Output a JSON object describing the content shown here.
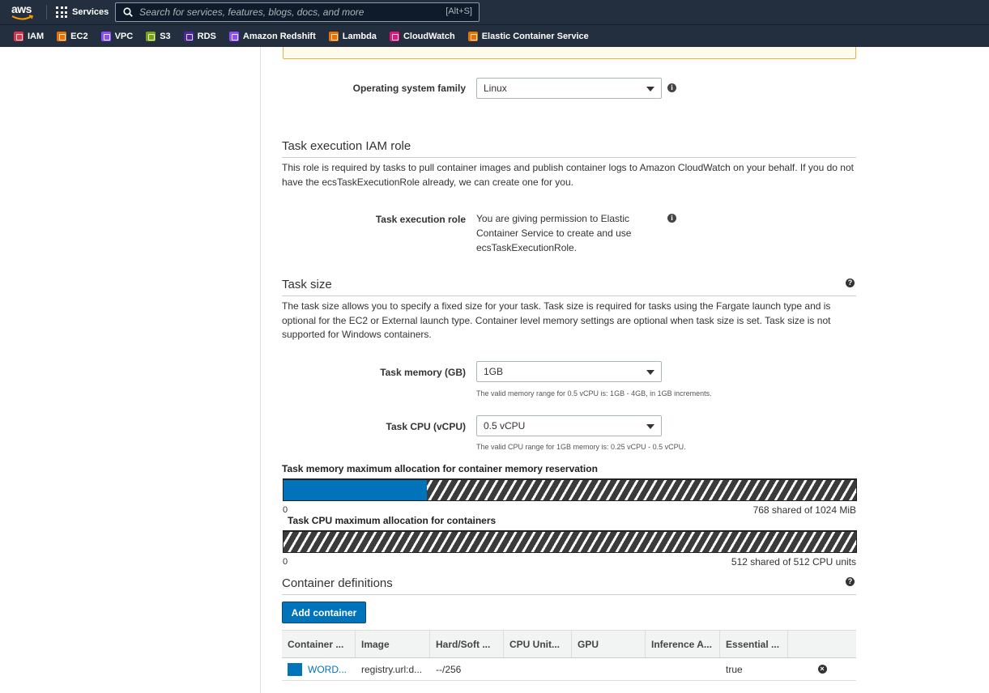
{
  "header": {
    "logo_text": "aws",
    "services_label": "Services",
    "search_placeholder": "Search for services, features, blogs, docs, and more",
    "search_shortcut": "[Alt+S]"
  },
  "favorites": [
    {
      "label": "IAM",
      "color": "#dd344c"
    },
    {
      "label": "EC2",
      "color": "#ed7100"
    },
    {
      "label": "VPC",
      "color": "#8c4fff"
    },
    {
      "label": "S3",
      "color": "#7aa116"
    },
    {
      "label": "RDS",
      "color": "#4d27a8"
    },
    {
      "label": "Amazon Redshift",
      "color": "#8c4fff"
    },
    {
      "label": "Lambda",
      "color": "#ed7100"
    },
    {
      "label": "CloudWatch",
      "color": "#e7157b"
    },
    {
      "label": "Elastic Container Service",
      "color": "#ed7100"
    }
  ],
  "os_family": {
    "label": "Operating system family",
    "value": "Linux"
  },
  "task_execution": {
    "title": "Task execution IAM role",
    "description": "This role is required by tasks to pull container images and publish container logs to Amazon CloudWatch on your behalf. If you do not have the ecsTaskExecutionRole already, we can create one for you.",
    "role_label": "Task execution role",
    "role_text": "You are giving permission to Elastic Container Service to create and use ecsTaskExecutionRole."
  },
  "task_size": {
    "title": "Task size",
    "description": "The task size allows you to specify a fixed size for your task. Task size is required for tasks using the Fargate launch type and is optional for the EC2 or External launch type. Container level memory settings are optional when task size is set. Task size is not supported for Windows containers.",
    "memory_label": "Task memory (GB)",
    "memory_value": "1GB",
    "memory_hint": "The valid memory range for 0.5 vCPU is: 1GB - 4GB, in 1GB increments.",
    "cpu_label": "Task CPU (vCPU)",
    "cpu_value": "0.5 vCPU",
    "cpu_hint": "The valid CPU range for 1GB memory is: 0.25 vCPU - 0.5 vCPU."
  },
  "memory_allocation": {
    "title": "Task memory maximum allocation for container memory reservation",
    "min": "0",
    "max_text": "768 shared of 1024 MiB",
    "reserved_fraction": 0.25
  },
  "cpu_allocation": {
    "title": "Task CPU maximum allocation for containers",
    "min": "0",
    "max_text": "512 shared of 512 CPU units",
    "reserved_fraction": 0
  },
  "container_definitions": {
    "title": "Container definitions",
    "add_button": "Add container",
    "columns": [
      "Container ...",
      "Image",
      "Hard/Soft ...",
      "CPU Unit...",
      "GPU",
      "Inference A...",
      "Essential ..."
    ],
    "rows": [
      {
        "name": "WORD...",
        "image": "registry.url:d...",
        "memory": "--/256",
        "cpu": "",
        "gpu": "",
        "inference": "",
        "essential": "true",
        "color": "#0073bb"
      }
    ]
  }
}
